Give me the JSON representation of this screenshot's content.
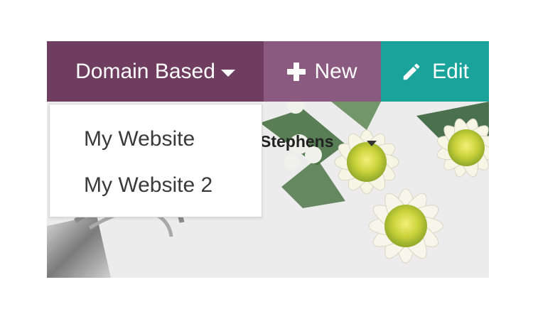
{
  "toolbar": {
    "website_switcher_label": "Domain Based",
    "new_label": "New",
    "edit_label": "Edit"
  },
  "dropdown": {
    "items": [
      {
        "label": "My Website"
      },
      {
        "label": "My Website 2"
      }
    ]
  },
  "user_menu": {
    "label": "Stephens"
  },
  "colors": {
    "switcher_bg": "#6e3d60",
    "new_bg": "#8b5a80",
    "edit_bg": "#1aa39a"
  },
  "icons": [
    "chevron-down-icon",
    "plus-icon",
    "pencil-icon"
  ]
}
